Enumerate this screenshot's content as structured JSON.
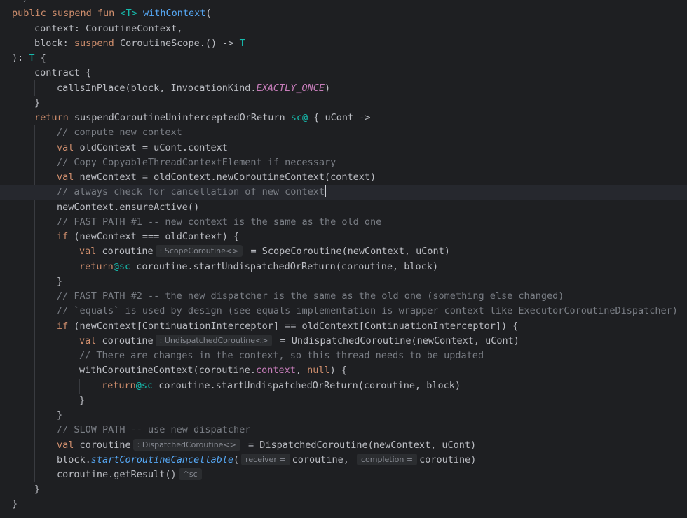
{
  "editor": {
    "lines": {
      "c0": "*/",
      "l1": {
        "kw1": "public suspend fun ",
        "ty": "<T> ",
        "fn": "withContext",
        "rest": "("
      },
      "l2": "context: CoroutineContext,",
      "l3": {
        "a": "block: ",
        "kw": "suspend ",
        "b": "CoroutineScope.() -> ",
        "ty": "T"
      },
      "l4": {
        "a": "): ",
        "ty": "T",
        "b": " {"
      },
      "l5": "contract {",
      "l6": {
        "a": "callsInPlace(block, InvocationKind.",
        "it": "EXACTLY_ONCE",
        "b": ")"
      },
      "l7": "}",
      "l8": {
        "kw": "return ",
        "a": "suspendCoroutineUninterceptedOrReturn ",
        "lab": "sc@",
        "b": " { uCont ->"
      },
      "l9": "// compute new context",
      "l10": {
        "kw": "val ",
        "a": "oldContext = uCont.context"
      },
      "l11": "// Copy CopyableThreadContextElement if necessary",
      "l12": {
        "kw": "val ",
        "a": "newContext = oldContext.newCoroutineContext(context)"
      },
      "l13": "// always check for cancellation of new context",
      "l14": "newContext.ensureActive()",
      "l15": "// FAST PATH #1 -- new context is the same as the old one",
      "l16": {
        "kw": "if ",
        "a": "(newContext === oldContext) {"
      },
      "l17": {
        "kw": "val ",
        "a": "coroutine",
        "hint": ": ScopeCoroutine<>",
        "b": " = ScopeCoroutine(newContext, uCont)"
      },
      "l18": {
        "kw": "return",
        "lab": "@sc",
        "a": " coroutine.startUndispatchedOrReturn(coroutine, block)"
      },
      "l19": "}",
      "l20": "// FAST PATH #2 -- the new dispatcher is the same as the old one (something else changed)",
      "l21": "// `equals` is used by design (see equals implementation is wrapper context like ExecutorCoroutineDispatcher)",
      "l22": {
        "kw": "if ",
        "a": "(newContext[ContinuationInterceptor] == oldContext[ContinuationInterceptor]) {"
      },
      "l23": {
        "kw": "val ",
        "a": "coroutine",
        "hint": ": UndispatchedCoroutine<>",
        "b": " = UndispatchedCoroutine(newContext, uCont)"
      },
      "l24": "// There are changes in the context, so this thread needs to be updated",
      "l25": {
        "a": "withCoroutineContext(coroutine.",
        "prop": "context",
        "b": ", ",
        "kw": "null",
        "c": ") {"
      },
      "l26": {
        "kw": "return",
        "lab": "@sc",
        "a": " coroutine.startUndispatchedOrReturn(coroutine, block)"
      },
      "l27": "}",
      "l28": "}",
      "l29": "// SLOW PATH -- use new dispatcher",
      "l30": {
        "kw": "val ",
        "a": "coroutine",
        "hint": ": DispatchedCoroutine<>",
        "b": " = DispatchedCoroutine(newContext, uCont)"
      },
      "l31": {
        "a": "block.",
        "ext": "startCoroutineCancellable",
        "b": "(",
        "hint1": "receiver =",
        "c": "coroutine, ",
        "hint2": "completion =",
        "d": "coroutine)"
      },
      "l32": {
        "a": "coroutine.getResult()",
        "hint": "^sc"
      },
      "l33": "}",
      "l34": "}"
    }
  }
}
